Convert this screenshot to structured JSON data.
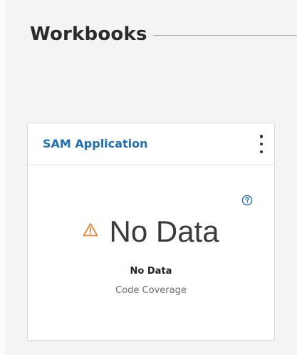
{
  "section": {
    "title": "Workbooks"
  },
  "card": {
    "title": "SAM Application",
    "menu_icon": "overflow-menu-vertical-icon",
    "help_icon": "help-circle-icon",
    "warning_icon": "warning-triangle-icon",
    "warning_color": "#f0822c",
    "title_color": "#1f6fb5",
    "metric_value": "No Data",
    "status_label": "No Data",
    "metric_name": "Code Coverage"
  }
}
